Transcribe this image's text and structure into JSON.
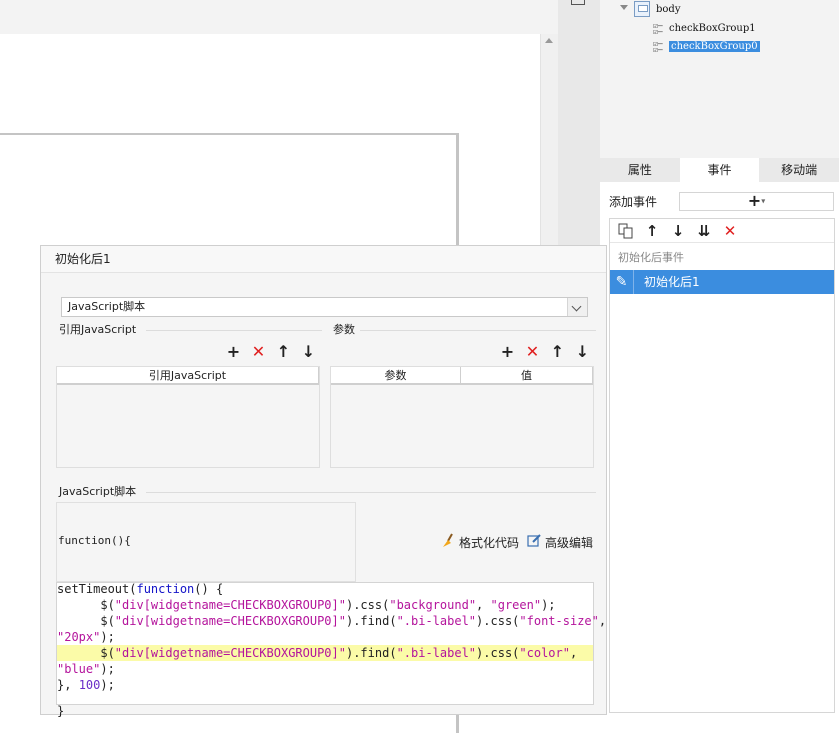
{
  "tree": {
    "root": "body",
    "children": [
      "checkBoxGroup1",
      "checkBoxGroup0"
    ],
    "selected": "checkBoxGroup0"
  },
  "tabs": [
    {
      "label": "属性",
      "active": false
    },
    {
      "label": "事件",
      "active": true
    },
    {
      "label": "移动端",
      "active": false
    }
  ],
  "events_panel": {
    "add_event_label": "添加事件",
    "add_symbol": "+",
    "list_header": "初始化后事件",
    "items": [
      "初始化后1"
    ]
  },
  "dialog": {
    "title": "初始化后1",
    "script_type": "JavaScript脚本",
    "ref_section_label": "引用JavaScript",
    "ref_table_header": "引用JavaScript",
    "params_section_label": "参数",
    "params_headers": [
      "参数",
      "值"
    ],
    "script_section_label": "JavaScript脚本",
    "function_header": "function(){",
    "format_code_label": "格式化代码",
    "advanced_edit_label": "高级编辑",
    "code_lines": [
      "setTimeout(function() {",
      "      $(\"div[widgetname=CHECKBOXGROUP0]\").css(\"background\", \"green\");",
      "      $(\"div[widgetname=CHECKBOXGROUP0]\").find(\".bi-label\").css(\"font-size\",",
      "\"20px\");",
      "      $(\"div[widgetname=CHECKBOXGROUP0]\").find(\".bi-label\").css(\"color\",",
      "\"blue\");",
      "}, 100);"
    ],
    "highlighted_line": 5,
    "closing": "}"
  },
  "colors": {
    "selection": "#3b8ddf",
    "delete": "#e02020",
    "highlight_line": "#fbfba8"
  }
}
